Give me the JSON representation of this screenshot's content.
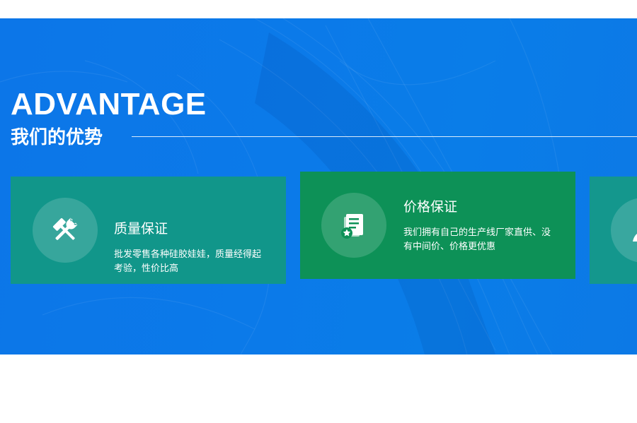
{
  "advantage": {
    "title_en": "ADVANTAGE",
    "title_cn": "我们的优势"
  },
  "cards": [
    {
      "title": "质量保证",
      "desc": "批发零售各种硅胶娃娃，质量经得起考验，性价比高",
      "icon": "tools-icon",
      "color": "#11968a"
    },
    {
      "title": "价格保证",
      "desc": "我们拥有自己的生产线厂家直供、没有中间价、价格更优惠",
      "icon": "document-star-icon",
      "color": "#0d9157"
    },
    {
      "title": "",
      "desc": "",
      "icon": "user-icon",
      "color": "#14978d"
    }
  ],
  "colors": {
    "banner_blue": "#0c78e8",
    "text": "#ffffff"
  }
}
